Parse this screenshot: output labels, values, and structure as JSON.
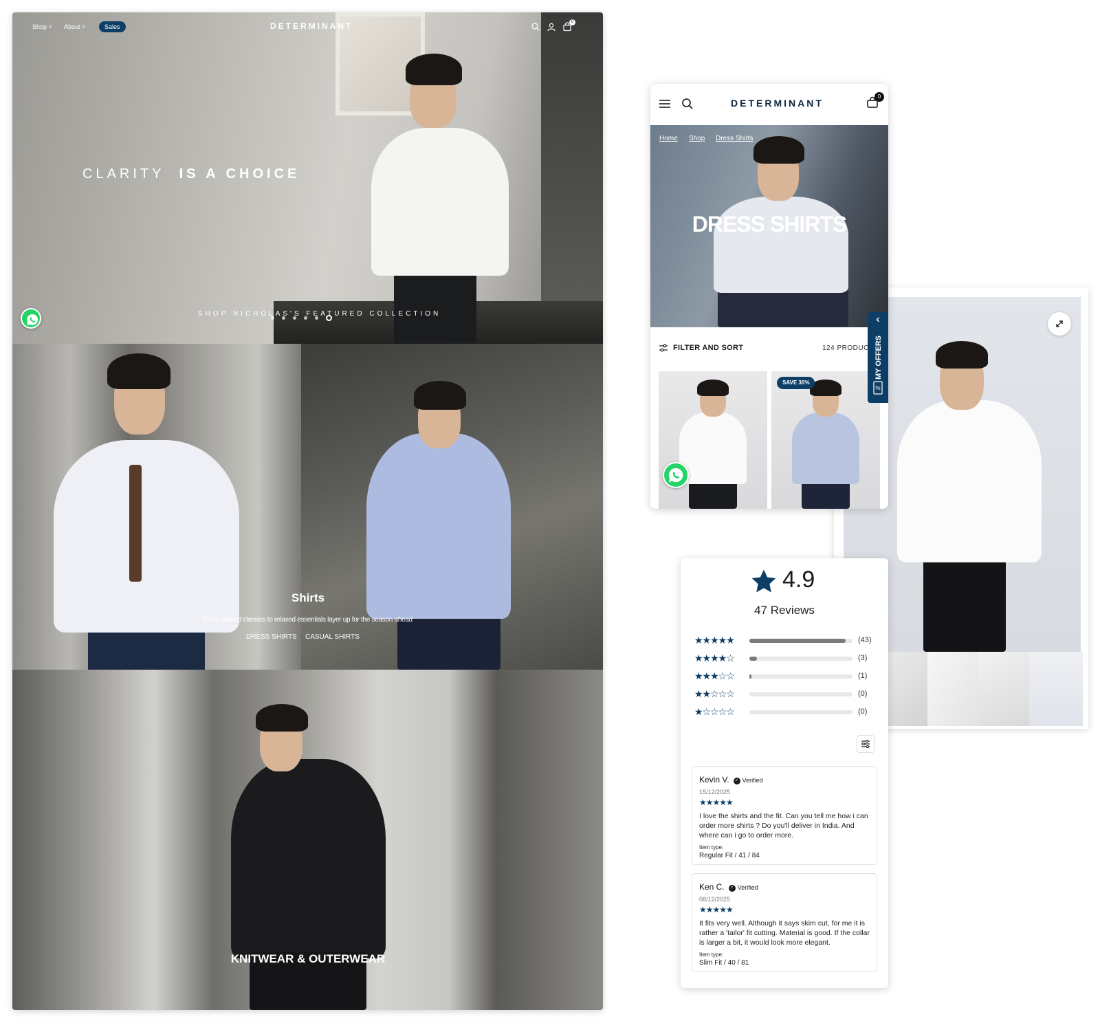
{
  "desktop": {
    "nav": {
      "shop": "Shop",
      "about": "About",
      "sales": "Sales",
      "brand": "DETERMINANT",
      "cart_count": "0",
      "icons": [
        "search-icon",
        "account-icon",
        "cart-icon"
      ]
    },
    "hero": {
      "title_light": "CLARITY",
      "title_bold": "IS A CHOICE",
      "cta": "SHOP NICHOLAS'S FEATURED COLLECTION",
      "slides": 6,
      "active_slide": 6
    },
    "shirts": {
      "title": "Shirts",
      "subtitle": "From tailored classics to relaxed essentials layer up for the season ahead",
      "links": [
        "DRESS SHIRTS",
        "CASUAL SHIRTS"
      ]
    },
    "outerwear": {
      "title": "KNITWEAR & OUTERWEAR"
    }
  },
  "mobile": {
    "brand": "DETERMINANT",
    "cart_count": "0",
    "breadcrumbs": [
      "Home",
      "Shop",
      "Dress Shirts"
    ],
    "hero_title": "DRESS SHIRTS",
    "filter_label": "FILTER AND SORT",
    "count_label": "124 PRODUC",
    "products": [
      {
        "badge": ""
      },
      {
        "badge": "SAVE 30%"
      }
    ],
    "offers_tab": "MY OFFERS"
  },
  "reviews": {
    "rating": "4.9",
    "count_label": "47 Reviews",
    "distribution": [
      {
        "stars": 5,
        "count": "(43)",
        "fraction": 0.93
      },
      {
        "stars": 4,
        "count": "(3)",
        "fraction": 0.07
      },
      {
        "stars": 3,
        "count": "(1)",
        "fraction": 0.02
      },
      {
        "stars": 2,
        "count": "(0)",
        "fraction": 0
      },
      {
        "stars": 1,
        "count": "(0)",
        "fraction": 0
      }
    ],
    "items": [
      {
        "name": "Kevin V.",
        "verified": "Verified",
        "date": "15/12/2025",
        "stars": "★★★★★",
        "text": "I love the shirts and the fit. Can you tell me how i can order more shirts ? Do you'll deliver in India. And where can i go to order more.",
        "item_type_label": "Item type:",
        "item_type": "Regular Fit / 41 / 84"
      },
      {
        "name": "Ken C.",
        "verified": "Verified",
        "date": "08/12/2025",
        "stars": "★★★★★",
        "text": "It fits very well. Although it says skim cut, for me it is rather a 'tailor' fit cutting. Material is good. If the collar is larger a bit, it would look more elegant.",
        "item_type_label": "Item type:",
        "item_type": "Slim Fit / 40 / 81"
      }
    ]
  },
  "colors": {
    "brand_navy": "#0c3e66",
    "whatsapp_green": "#25d366"
  }
}
